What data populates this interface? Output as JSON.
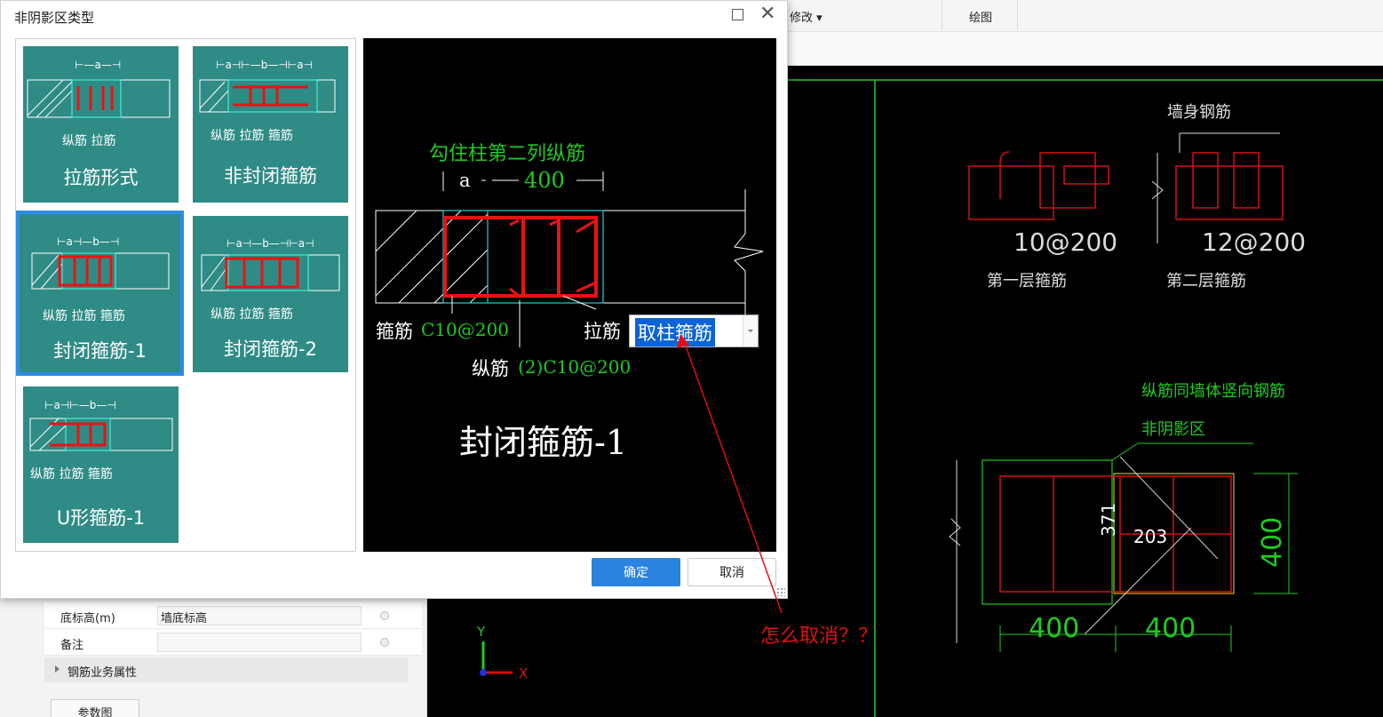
{
  "toolbar": {
    "modify_label": "修改 ▾",
    "draw_label": "绘图"
  },
  "dialog": {
    "title": "非阴影区类型",
    "ok_label": "确定",
    "cancel_label": "取消"
  },
  "tiles": [
    {
      "title": "拉筋形式",
      "sub": "纵筋   拉筋",
      "dims": "⊢—a—⊣"
    },
    {
      "title": "非封闭箍筋",
      "sub": "纵筋  拉筋  箍筋",
      "dims": "⊢a⊣⊢—b—⊣⊢a⊣"
    },
    {
      "title": "封闭箍筋-1",
      "sub": "纵筋  拉筋   箍筋",
      "dims": "⊢a⊣—b—⊣"
    },
    {
      "title": "封闭箍筋-2",
      "sub": "纵筋  拉筋   箍筋",
      "dims": "⊢a⊣—b—⊣⊢a⊣"
    },
    {
      "title": "U形箍筋-1",
      "sub": "纵筋  拉筋  箍筋",
      "dims": "⊢a⊣⊢—b—⊣"
    }
  ],
  "preview": {
    "top_note": "勾住柱第二列纵筋",
    "dim_a": "a",
    "dim_400": "400",
    "stirrup_label": "箍筋",
    "stirrup_value": "C10@200",
    "tie_label": "拉筋",
    "tie_combo_value": "取柱箍筋",
    "long_label": "纵筋",
    "long_value": "(2)C10@200",
    "big_title": "封闭箍筋-1"
  },
  "cad": {
    "wall_rebar": "墙身钢筋",
    "bar1": "10@200",
    "bar2": "12@200",
    "layer1": "第一层箍筋",
    "layer2": "第二层箍筋",
    "note1": "纵筋同墙体竖向钢筋",
    "note2": "非阴影区",
    "dim371": "371",
    "dim203": "203",
    "dim400a": "400",
    "dim400b": "400",
    "dim400c": "400",
    "axis_y": "Y",
    "axis_x": "X"
  },
  "props": {
    "rows": [
      {
        "label": "底标高(m)",
        "value": "墙底标高"
      },
      {
        "label": "备注",
        "value": ""
      }
    ],
    "group_label": "钢筋业务属性",
    "param_button": "参数图"
  },
  "annotation": "怎么取消？？"
}
